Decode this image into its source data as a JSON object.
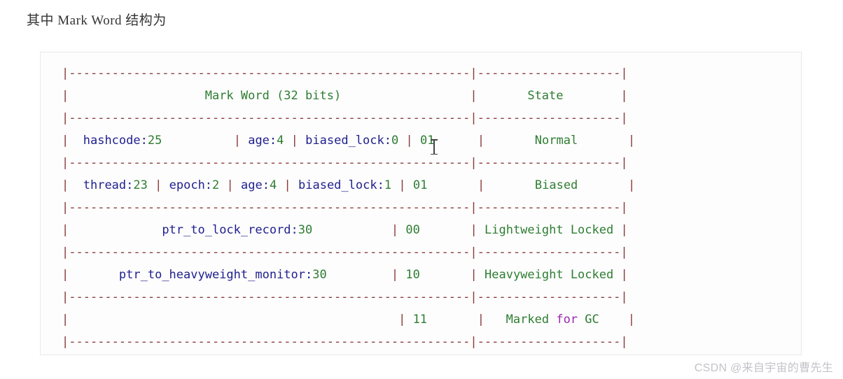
{
  "page": {
    "heading": "其中 Mark Word 结构为",
    "watermark": "CSDN @来自宇宙的曹先生"
  },
  "colors": {
    "identifier": "#1f1f8f",
    "number": "#2e7d32",
    "string": "#2e7d32",
    "keyword": "#9c27b0",
    "separator": "#8b3a3a",
    "code_background": "#fdfdfd",
    "code_border": "#e9e9e9",
    "page_background": "#ffffff",
    "heading_text": "#333333",
    "watermark_text": "#c3c3c9"
  },
  "code_block": {
    "language": "text",
    "caret_visible": true,
    "raw": "|--------------------------------------------------------|--------------------|\n|                    Mark Word (32 bits)                 |       State        |\n|--------------------------------------------------------|--------------------|\n|  hashcode:25          | age:4 | biased_lock:0 | 01      |       Normal       |\n|--------------------------------------------------------|--------------------|\n|  thread:23 | epoch:2 | age:4 | biased_lock:1 | 01       |       Biased       |\n|--------------------------------------------------------|--------------------|\n|              ptr_to_lock_record:30           | 00       | Lightweight Locked |\n|--------------------------------------------------------|--------------------|\n|        ptr_to_heavyweight_monitor:30         | 10       | Heavyweight Locked |\n|--------------------------------------------------------|--------------------|\n|                                              | 11       |   Marked for GC    |\n|--------------------------------------------------------|--------------------|",
    "lines": [
      {
        "type": "separator",
        "tokens": [
          {
            "t": "|",
            "c": "sep"
          },
          {
            "t": "--------------------------------------------------------",
            "c": "sep"
          },
          {
            "t": "|",
            "c": "sep"
          },
          {
            "t": "--------------------",
            "c": "sep"
          },
          {
            "t": "|",
            "c": "sep"
          }
        ]
      },
      {
        "type": "header",
        "tokens": [
          {
            "t": "|",
            "c": "pipe"
          },
          {
            "t": "                   ",
            "c": "plain"
          },
          {
            "t": "Mark Word (32 bits)",
            "c": "str"
          },
          {
            "t": "                  ",
            "c": "plain"
          },
          {
            "t": "|",
            "c": "pipe"
          },
          {
            "t": "       ",
            "c": "plain"
          },
          {
            "t": "State",
            "c": "str"
          },
          {
            "t": "        ",
            "c": "plain"
          },
          {
            "t": "|",
            "c": "pipe"
          }
        ]
      },
      {
        "type": "separator",
        "tokens": [
          {
            "t": "|",
            "c": "sep"
          },
          {
            "t": "--------------------------------------------------------",
            "c": "sep"
          },
          {
            "t": "|",
            "c": "sep"
          },
          {
            "t": "--------------------",
            "c": "sep"
          },
          {
            "t": "|",
            "c": "sep"
          }
        ]
      },
      {
        "type": "data",
        "tokens": [
          {
            "t": "|",
            "c": "pipe"
          },
          {
            "t": "  ",
            "c": "plain"
          },
          {
            "t": "hashcode:",
            "c": "ident"
          },
          {
            "t": "25",
            "c": "num"
          },
          {
            "t": "          ",
            "c": "plain"
          },
          {
            "t": "|",
            "c": "pipe"
          },
          {
            "t": " ",
            "c": "plain"
          },
          {
            "t": "age:",
            "c": "ident"
          },
          {
            "t": "4",
            "c": "num"
          },
          {
            "t": " ",
            "c": "plain"
          },
          {
            "t": "|",
            "c": "pipe"
          },
          {
            "t": " ",
            "c": "plain"
          },
          {
            "t": "biased_lock:",
            "c": "ident"
          },
          {
            "t": "0",
            "c": "num"
          },
          {
            "t": " ",
            "c": "plain"
          },
          {
            "t": "|",
            "c": "pipe"
          },
          {
            "t": " ",
            "c": "plain"
          },
          {
            "t": "01",
            "c": "num"
          },
          {
            "t": "      ",
            "c": "plain"
          },
          {
            "t": "|",
            "c": "pipe"
          },
          {
            "t": "       ",
            "c": "plain"
          },
          {
            "t": "Normal",
            "c": "str"
          },
          {
            "t": "       ",
            "c": "plain"
          },
          {
            "t": "|",
            "c": "pipe"
          }
        ]
      },
      {
        "type": "separator",
        "tokens": [
          {
            "t": "|",
            "c": "sep"
          },
          {
            "t": "--------------------------------------------------------",
            "c": "sep"
          },
          {
            "t": "|",
            "c": "sep"
          },
          {
            "t": "--------------------",
            "c": "sep"
          },
          {
            "t": "|",
            "c": "sep"
          }
        ]
      },
      {
        "type": "data",
        "tokens": [
          {
            "t": "|",
            "c": "pipe"
          },
          {
            "t": "  ",
            "c": "plain"
          },
          {
            "t": "thread:",
            "c": "ident"
          },
          {
            "t": "23",
            "c": "num"
          },
          {
            "t": " ",
            "c": "plain"
          },
          {
            "t": "|",
            "c": "pipe"
          },
          {
            "t": " ",
            "c": "plain"
          },
          {
            "t": "epoch:",
            "c": "ident"
          },
          {
            "t": "2",
            "c": "num"
          },
          {
            "t": " ",
            "c": "plain"
          },
          {
            "t": "|",
            "c": "pipe"
          },
          {
            "t": " ",
            "c": "plain"
          },
          {
            "t": "age:",
            "c": "ident"
          },
          {
            "t": "4",
            "c": "num"
          },
          {
            "t": " ",
            "c": "plain"
          },
          {
            "t": "|",
            "c": "pipe"
          },
          {
            "t": " ",
            "c": "plain"
          },
          {
            "t": "biased_lock:",
            "c": "ident"
          },
          {
            "t": "1",
            "c": "num"
          },
          {
            "t": " ",
            "c": "plain"
          },
          {
            "t": "|",
            "c": "pipe"
          },
          {
            "t": " ",
            "c": "plain"
          },
          {
            "t": "01",
            "c": "num"
          },
          {
            "t": "       ",
            "c": "plain"
          },
          {
            "t": "|",
            "c": "pipe"
          },
          {
            "t": "       ",
            "c": "plain"
          },
          {
            "t": "Biased",
            "c": "str"
          },
          {
            "t": "       ",
            "c": "plain"
          },
          {
            "t": "|",
            "c": "pipe"
          }
        ]
      },
      {
        "type": "separator",
        "tokens": [
          {
            "t": "|",
            "c": "sep"
          },
          {
            "t": "--------------------------------------------------------",
            "c": "sep"
          },
          {
            "t": "|",
            "c": "sep"
          },
          {
            "t": "--------------------",
            "c": "sep"
          },
          {
            "t": "|",
            "c": "sep"
          }
        ]
      },
      {
        "type": "data",
        "tokens": [
          {
            "t": "|",
            "c": "pipe"
          },
          {
            "t": "             ",
            "c": "plain"
          },
          {
            "t": "ptr_to_lock_record:",
            "c": "ident"
          },
          {
            "t": "30",
            "c": "num"
          },
          {
            "t": "           ",
            "c": "plain"
          },
          {
            "t": "|",
            "c": "pipe"
          },
          {
            "t": " ",
            "c": "plain"
          },
          {
            "t": "00",
            "c": "num"
          },
          {
            "t": "       ",
            "c": "plain"
          },
          {
            "t": "|",
            "c": "pipe"
          },
          {
            "t": " ",
            "c": "plain"
          },
          {
            "t": "Lightweight Locked",
            "c": "str"
          },
          {
            "t": " ",
            "c": "plain"
          },
          {
            "t": "|",
            "c": "pipe"
          }
        ]
      },
      {
        "type": "separator",
        "tokens": [
          {
            "t": "|",
            "c": "sep"
          },
          {
            "t": "--------------------------------------------------------",
            "c": "sep"
          },
          {
            "t": "|",
            "c": "sep"
          },
          {
            "t": "--------------------",
            "c": "sep"
          },
          {
            "t": "|",
            "c": "sep"
          }
        ]
      },
      {
        "type": "data",
        "tokens": [
          {
            "t": "|",
            "c": "pipe"
          },
          {
            "t": "       ",
            "c": "plain"
          },
          {
            "t": "ptr_to_heavyweight_monitor:",
            "c": "ident"
          },
          {
            "t": "30",
            "c": "num"
          },
          {
            "t": "         ",
            "c": "plain"
          },
          {
            "t": "|",
            "c": "pipe"
          },
          {
            "t": " ",
            "c": "plain"
          },
          {
            "t": "10",
            "c": "num"
          },
          {
            "t": "       ",
            "c": "plain"
          },
          {
            "t": "|",
            "c": "pipe"
          },
          {
            "t": " ",
            "c": "plain"
          },
          {
            "t": "Heavyweight Locked",
            "c": "str"
          },
          {
            "t": " ",
            "c": "plain"
          },
          {
            "t": "|",
            "c": "pipe"
          }
        ]
      },
      {
        "type": "separator",
        "tokens": [
          {
            "t": "|",
            "c": "sep"
          },
          {
            "t": "--------------------------------------------------------",
            "c": "sep"
          },
          {
            "t": "|",
            "c": "sep"
          },
          {
            "t": "--------------------",
            "c": "sep"
          },
          {
            "t": "|",
            "c": "sep"
          }
        ]
      },
      {
        "type": "data",
        "tokens": [
          {
            "t": "|",
            "c": "pipe"
          },
          {
            "t": "                                              ",
            "c": "plain"
          },
          {
            "t": "|",
            "c": "pipe"
          },
          {
            "t": " ",
            "c": "plain"
          },
          {
            "t": "11",
            "c": "num"
          },
          {
            "t": "       ",
            "c": "plain"
          },
          {
            "t": "|",
            "c": "pipe"
          },
          {
            "t": "   ",
            "c": "plain"
          },
          {
            "t": "Marked ",
            "c": "str"
          },
          {
            "t": "for",
            "c": "kw"
          },
          {
            "t": " GC",
            "c": "str"
          },
          {
            "t": "    ",
            "c": "plain"
          },
          {
            "t": "|",
            "c": "pipe"
          }
        ]
      },
      {
        "type": "separator",
        "tokens": [
          {
            "t": "|",
            "c": "sep"
          },
          {
            "t": "--------------------------------------------------------",
            "c": "sep"
          },
          {
            "t": "|",
            "c": "sep"
          },
          {
            "t": "--------------------",
            "c": "sep"
          },
          {
            "t": "|",
            "c": "sep"
          }
        ]
      }
    ],
    "table_semantics": {
      "columns": [
        "Mark Word (32 bits)",
        "State"
      ],
      "rows": [
        {
          "fields": "hashcode:25 | age:4 | biased_lock:0 | 01",
          "state": "Normal"
        },
        {
          "fields": "thread:23 | epoch:2 | age:4 | biased_lock:1 | 01",
          "state": "Biased"
        },
        {
          "fields": "ptr_to_lock_record:30 | 00",
          "state": "Lightweight Locked"
        },
        {
          "fields": "ptr_to_heavyweight_monitor:30 | 10",
          "state": "Heavyweight Locked"
        },
        {
          "fields": "| 11",
          "state": "Marked for GC"
        }
      ]
    }
  }
}
